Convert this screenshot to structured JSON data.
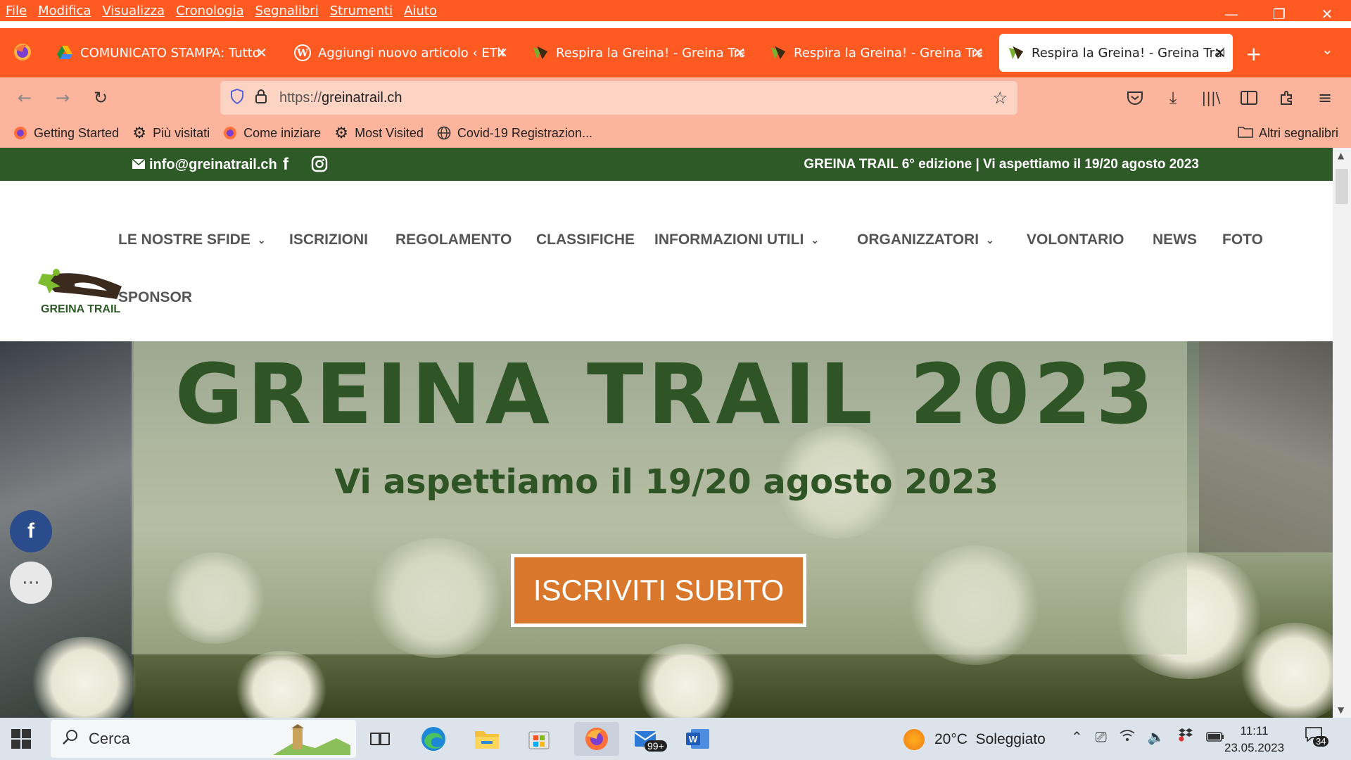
{
  "menubar": {
    "items": [
      "File",
      "Modifica",
      "Visualizza",
      "Cronologia",
      "Segnalibri",
      "Strumenti",
      "Aiuto"
    ]
  },
  "tabs": [
    {
      "title": "COMUNICATO STAMPA: Tutto è",
      "icon": "google-drive-icon"
    },
    {
      "title": "Aggiungi nuovo articolo ‹ ETiCi",
      "icon": "wordpress-icon"
    },
    {
      "title": "Respira la Greina! - Greina Trail",
      "icon": "greina-favicon"
    },
    {
      "title": "Respira la Greina! - Greina Trail",
      "icon": "greina-favicon"
    },
    {
      "title": "Respira la Greina! - Greina Trail",
      "icon": "greina-favicon",
      "active": true
    }
  ],
  "urlbar": {
    "proto": "https://",
    "domain": "greinatrail.ch"
  },
  "bookmarks": [
    {
      "label": "Getting Started",
      "icon": "firefox-icon"
    },
    {
      "label": "Più visitati",
      "icon": "gear-icon"
    },
    {
      "label": "Come iniziare",
      "icon": "firefox-icon"
    },
    {
      "label": "Most Visited",
      "icon": "gear-icon"
    },
    {
      "label": "Covid-19 Registrazion...",
      "icon": "globe-icon"
    }
  ],
  "bookmarks_other": "Altri segnalibri",
  "site": {
    "topbar": {
      "email": "info@greinatrail.ch",
      "tagline": "GREINA TRAIL 6° edizione | Vi aspettiamo il 19/20 agosto 2023"
    },
    "logo_text": "GREINA TRAIL",
    "nav": [
      {
        "label": "LE NOSTRE SFIDE",
        "dropdown": true
      },
      {
        "label": "ISCRIZIONI",
        "dropdown": false
      },
      {
        "label": "REGOLAMENTO",
        "dropdown": false
      },
      {
        "label": "CLASSIFICHE",
        "dropdown": false
      },
      {
        "label": "INFORMAZIONI UTILI",
        "dropdown": true
      },
      {
        "label": "ORGANIZZATORI",
        "dropdown": true
      },
      {
        "label": "VOLONTARIO",
        "dropdown": false
      },
      {
        "label": "NEWS",
        "dropdown": false
      },
      {
        "label": "FOTO",
        "dropdown": false
      },
      {
        "label": "SPONSOR",
        "dropdown": false
      }
    ],
    "hero": {
      "title": "GREINA TRAIL 2023",
      "subtitle": "Vi aspettiamo il 19/20 agosto 2023",
      "cta": "ISCRIVITI SUBITO"
    },
    "share": {
      "facebook": "f",
      "more": "⋯"
    }
  },
  "taskbar": {
    "search_placeholder": "Cerca",
    "mail_badge": "99+",
    "weather": "20°C  Soleggiato",
    "time": "11:11",
    "date": "23.05.2023",
    "notifications": "34"
  },
  "colors": {
    "firefox_orange": "#ff5a22",
    "toolbar_salmon": "#fcb59c",
    "site_green": "#2e5a27",
    "cta_orange": "#d9782d"
  }
}
